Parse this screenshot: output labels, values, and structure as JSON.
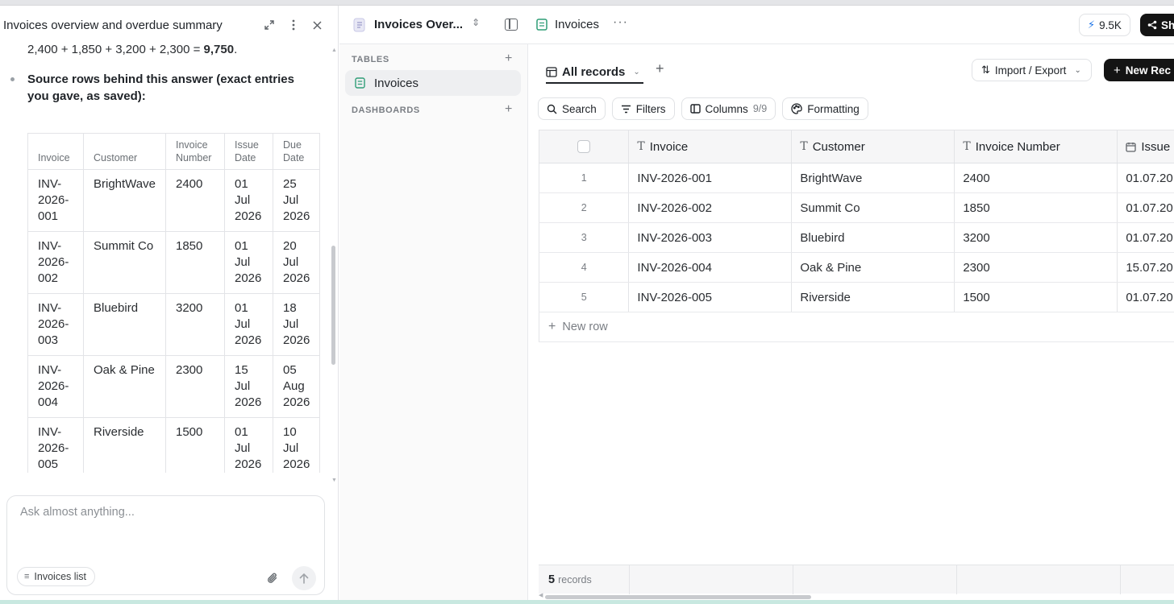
{
  "chat": {
    "title": "Invoices overview and overdue summary",
    "sum_prefix": "2,400 + 1,850 + 3,200 + 2,300 = ",
    "sum_total": "9,750",
    "sum_suffix": ".",
    "source_text": "Source rows behind this answer (exact entries you gave, as saved):",
    "table": {
      "headers": [
        "Invoice",
        "Customer",
        "Invoice Number",
        "Issue Date",
        "Due Date"
      ],
      "rows": [
        {
          "invoice": "INV-2026-001",
          "customer": "BrightWave",
          "number": "2400",
          "issue": "01 Jul 2026",
          "due": "25 Jul 2026"
        },
        {
          "invoice": "INV-2026-002",
          "customer": "Summit Co",
          "number": "1850",
          "issue": "01 Jul 2026",
          "due": "20 Jul 2026"
        },
        {
          "invoice": "INV-2026-003",
          "customer": "Bluebird",
          "number": "3200",
          "issue": "01 Jul 2026",
          "due": "18 Jul 2026"
        },
        {
          "invoice": "INV-2026-004",
          "customer": "Oak & Pine",
          "number": "2300",
          "issue": "15 Jul 2026",
          "due": "05 Aug 2026"
        },
        {
          "invoice": "INV-2026-005",
          "customer": "Riverside",
          "number": "1500",
          "issue": "01 Jul 2026",
          "due": "10 Jul 2026"
        }
      ]
    },
    "composer_placeholder": "Ask almost anything...",
    "context_chip": "Invoices list"
  },
  "header": {
    "base_name": "Invoices Over...",
    "table_name": "Invoices",
    "more": "···",
    "credits": "9.5K",
    "share_label": "Sh"
  },
  "sidebar": {
    "tables_label": "TABLES",
    "dashboards_label": "DASHBOARDS",
    "items": [
      {
        "label": "Invoices"
      }
    ]
  },
  "view": {
    "tab_label": "All records",
    "import_export": "Import / Export",
    "new_record": "New Rec"
  },
  "toolbar": {
    "search": "Search",
    "filters": "Filters",
    "columns": "Columns",
    "columns_count": "9/9",
    "formatting": "Formatting"
  },
  "grid": {
    "columns": [
      "Invoice",
      "Customer",
      "Invoice Number",
      "Issue"
    ],
    "rows": [
      {
        "n": "1",
        "invoice": "INV-2026-001",
        "customer": "BrightWave",
        "number": "2400",
        "issue": "01.07.20"
      },
      {
        "n": "2",
        "invoice": "INV-2026-002",
        "customer": "Summit Co",
        "number": "1850",
        "issue": "01.07.20"
      },
      {
        "n": "3",
        "invoice": "INV-2026-003",
        "customer": "Bluebird",
        "number": "3200",
        "issue": "01.07.20"
      },
      {
        "n": "4",
        "invoice": "INV-2026-004",
        "customer": "Oak & Pine",
        "number": "2300",
        "issue": "15.07.20"
      },
      {
        "n": "5",
        "invoice": "INV-2026-005",
        "customer": "Riverside",
        "number": "1500",
        "issue": "01.07.20"
      }
    ],
    "new_row": "New row",
    "record_count": "5",
    "records_label": "records"
  },
  "colors": {
    "accent_green": "#2f9e77",
    "primary_dark": "#141414",
    "bolt_blue": "#1a73e8"
  }
}
